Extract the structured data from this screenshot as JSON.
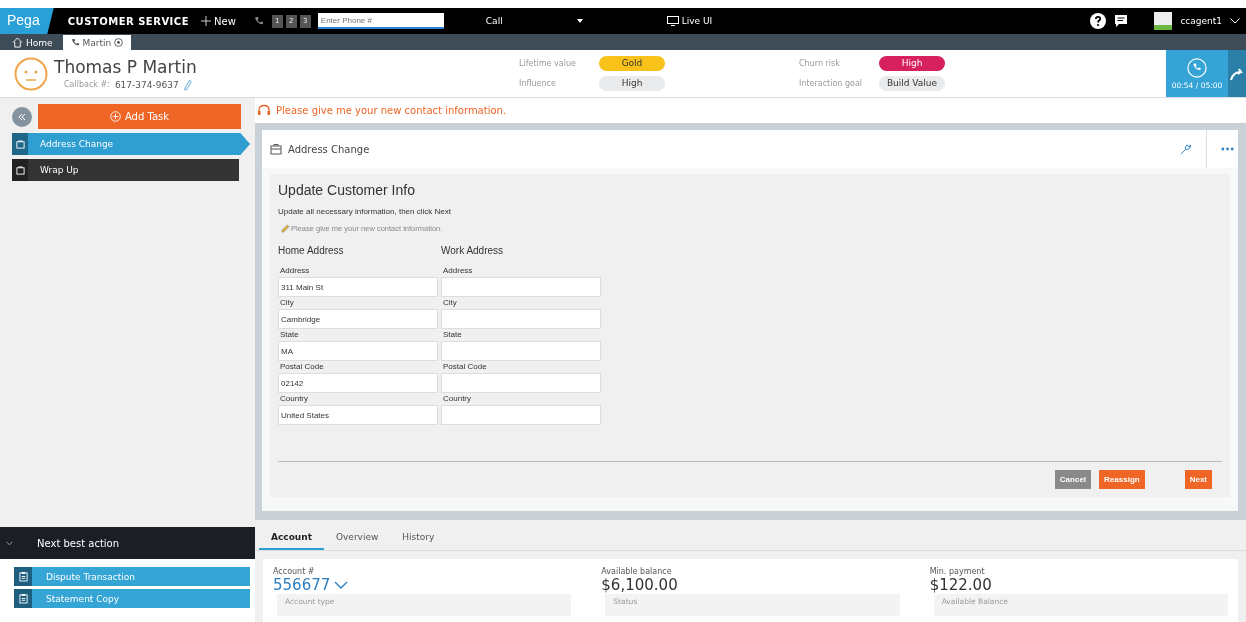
{
  "nav": {
    "brand": "Pega",
    "app": "CUSTOMER SERVICE",
    "new": "New",
    "lines": [
      "1",
      "2",
      "3"
    ],
    "phone": {
      "placeholder": "Enter Phone #"
    },
    "call": "Call",
    "live_ui": "Live UI",
    "user": "ccagent1"
  },
  "tabs": [
    {
      "label": "Home",
      "kind": "home",
      "selected": false
    },
    {
      "label": "Martin",
      "kind": "call",
      "selected": true
    }
  ],
  "customer": {
    "name": "Thomas P Martin",
    "callback_label": "Callback #:",
    "callback": "617-374-9637"
  },
  "attributes": [
    {
      "label": "Lifetime value",
      "value": "Gold",
      "color": "#f9c21b"
    },
    {
      "label": "Influence",
      "value": "High",
      "color": "#e9ebed"
    },
    {
      "label": "Churn risk",
      "value": "High",
      "color": "#d7215e"
    },
    {
      "label": "Interaction goal",
      "value": "Build Value",
      "color": "#e9ebed"
    }
  ],
  "call": {
    "timer": "00:54 / 05:00"
  },
  "sidebar": {
    "add_task": "Add Task",
    "tasks": [
      {
        "label": "Address Change",
        "selected": true
      },
      {
        "label": "Wrap Up",
        "selected": false
      }
    ]
  },
  "next_best_action": {
    "title": "Next best action",
    "items": [
      "Dispute Transaction",
      "Statement Copy"
    ]
  },
  "script": "Please give me your new contact information.",
  "case": {
    "title": "Address Change",
    "form": {
      "title": "Update Customer Info",
      "instruction": "Update all necessary information, then click Next",
      "hint": "Please give me your new contact information.",
      "sections": [
        {
          "heading": "Home Address",
          "fields": [
            {
              "label": "Address",
              "value": "311 Main St"
            },
            {
              "label": "City",
              "value": "Cambridge"
            },
            {
              "label": "State",
              "value": "MA"
            },
            {
              "label": "Postal Code",
              "value": "02142"
            },
            {
              "label": "Country",
              "value": "United States"
            }
          ]
        },
        {
          "heading": "Work Address",
          "fields": [
            {
              "label": "Address"
            },
            {
              "label": "City"
            },
            {
              "label": "State"
            },
            {
              "label": "Postal Code"
            },
            {
              "label": "Country"
            }
          ]
        }
      ],
      "buttons": [
        {
          "label": "Cancel",
          "kind": "secondary"
        },
        {
          "label": "Reassign",
          "kind": "primary"
        },
        {
          "label": "Next",
          "kind": "primary"
        }
      ]
    }
  },
  "bottom_tabs": [
    {
      "label": "Account",
      "selected": true
    },
    {
      "label": "Overview",
      "selected": false
    },
    {
      "label": "History",
      "selected": false
    }
  ],
  "account": [
    {
      "label": "Account #",
      "value": "556677",
      "kind": "link",
      "sub": "Account type"
    },
    {
      "label": "Available balance",
      "value": "$6,100.00",
      "kind": "plain",
      "sub": "Status"
    },
    {
      "label": "Min. payment",
      "value": "$122.00",
      "kind": "plain",
      "sub": "Available Balance"
    }
  ]
}
